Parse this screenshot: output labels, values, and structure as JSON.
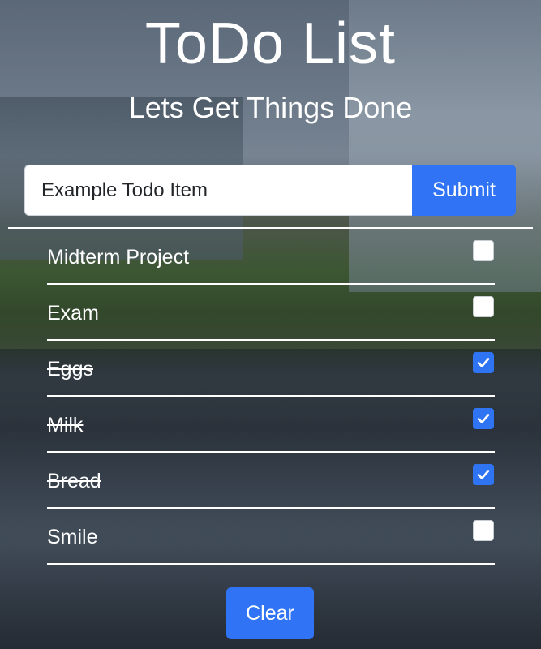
{
  "header": {
    "title": "ToDo List",
    "subtitle": "Lets Get Things Done"
  },
  "form": {
    "input_placeholder": "Example Todo Item",
    "input_value": "",
    "submit_label": "Submit"
  },
  "todos": [
    {
      "label": "Midterm Project",
      "done": false
    },
    {
      "label": "Exam",
      "done": false
    },
    {
      "label": "Eggs",
      "done": true
    },
    {
      "label": "Milk",
      "done": true
    },
    {
      "label": "Bread",
      "done": true
    },
    {
      "label": "Smile",
      "done": false
    }
  ],
  "footer": {
    "clear_label": "Clear"
  },
  "colors": {
    "accent": "#3074f5",
    "text": "#ffffff",
    "input_text": "#212529"
  },
  "icons": {
    "checkbox_checked": "check-icon",
    "background": "campus-building-photo"
  }
}
